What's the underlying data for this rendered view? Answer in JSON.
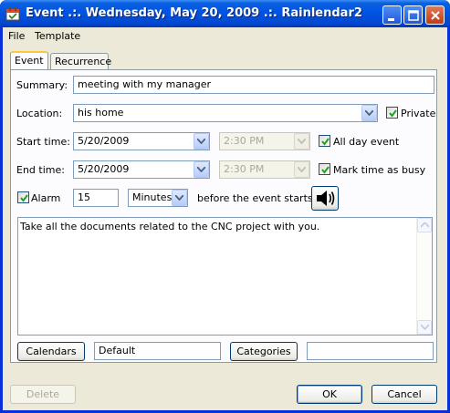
{
  "window": {
    "title": "Event .:. Wednesday, May 20, 2009 .:. Rainlendar2"
  },
  "menu": {
    "items": [
      "File",
      "Template"
    ]
  },
  "tabs": [
    {
      "label": "Event",
      "active": true
    },
    {
      "label": "Recurrence",
      "active": false
    }
  ],
  "form": {
    "summary_label": "Summary:",
    "summary_value": "meeting with my manager",
    "location_label": "Location:",
    "location_value": "his home",
    "private_label": "Private",
    "private_checked": true,
    "start_label": "Start time:",
    "start_date": "5/20/2009",
    "start_time": "2:30 PM",
    "all_day_label": "All day event",
    "all_day_checked": true,
    "end_label": "End time:",
    "end_date": "5/20/2009",
    "end_time": "2:30 PM",
    "busy_label": "Mark time as busy",
    "busy_checked": true,
    "alarm_label": "Alarm",
    "alarm_checked": true,
    "alarm_amount": "15",
    "alarm_unit": "Minutes",
    "alarm_suffix": "before the event starts.",
    "notes": "Take all the documents related to the CNC project with you.",
    "calendars_button": "Calendars",
    "calendars_value": "Default",
    "categories_button": "Categories",
    "categories_value": ""
  },
  "footer": {
    "delete_label": "Delete",
    "ok_label": "OK",
    "cancel_label": "Cancel"
  },
  "icons": [
    "app-icon",
    "minimize-icon",
    "maximize-icon",
    "close-icon",
    "chevron-down-icon",
    "checkmark-icon",
    "speaker-icon",
    "scroll-up-icon",
    "scroll-down-icon"
  ],
  "colors": {
    "title_bar": "#0054E3",
    "dialog_bg": "#ECE9D8",
    "active_tab_accent": "#FFC83C"
  }
}
